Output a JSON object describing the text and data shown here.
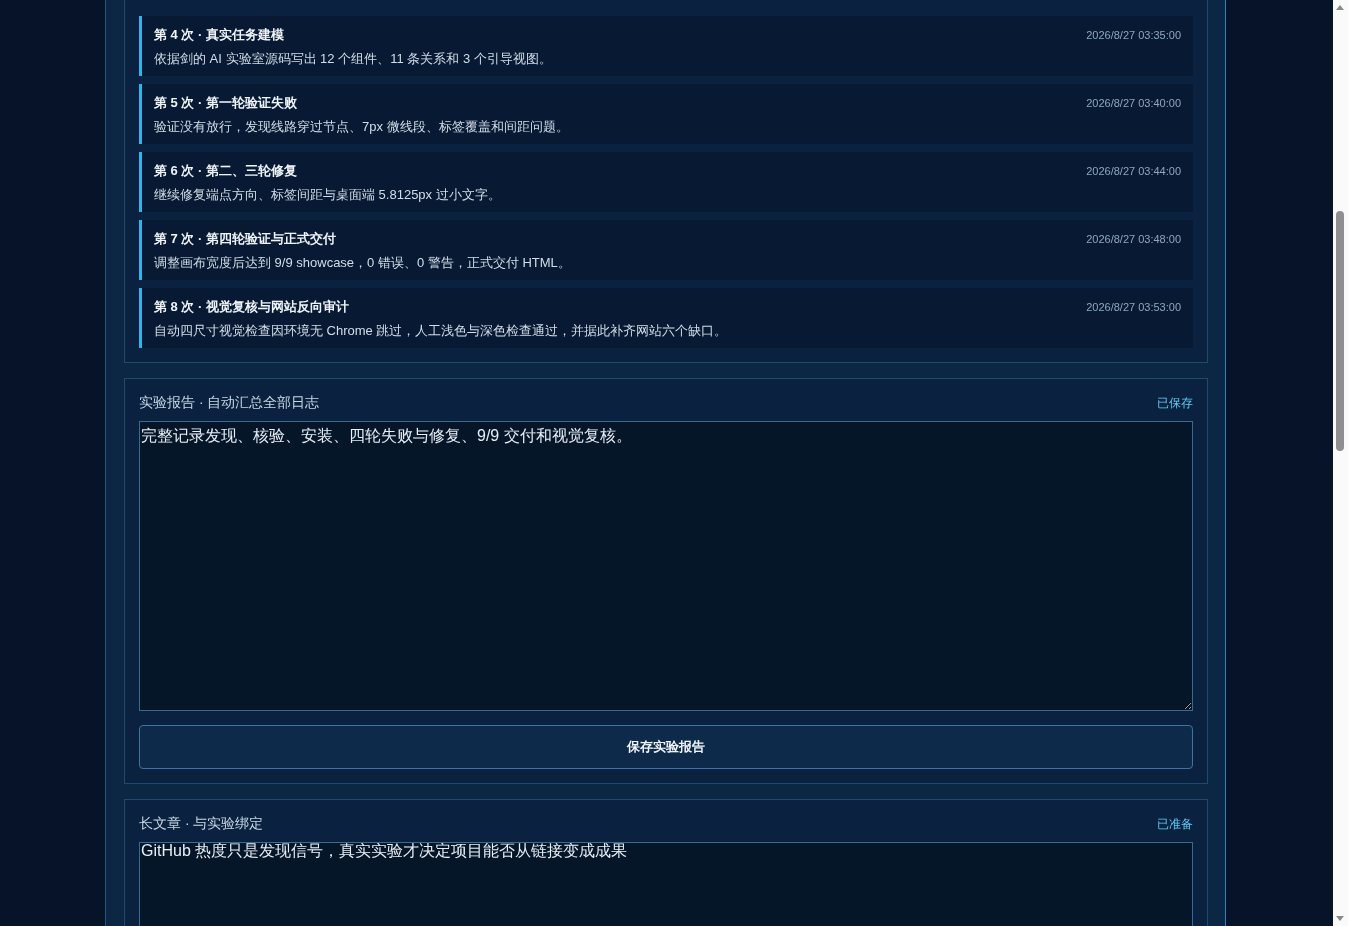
{
  "log_entries": [
    {
      "title": "第 4 次 · 真实任务建模",
      "time": "2026/8/27 03:35:00",
      "text": "依据剑的 AI 实验室源码写出 12 个组件、11 条关系和 3 个引导视图。"
    },
    {
      "title": "第 5 次 · 第一轮验证失败",
      "time": "2026/8/27 03:40:00",
      "text": "验证没有放行，发现线路穿过节点、7px 微线段、标签覆盖和间距问题。"
    },
    {
      "title": "第 6 次 · 第二、三轮修复",
      "time": "2026/8/27 03:44:00",
      "text": "继续修复端点方向、标签间距与桌面端 5.8125px 过小文字。"
    },
    {
      "title": "第 7 次 · 第四轮验证与正式交付",
      "time": "2026/8/27 03:48:00",
      "text": "调整画布宽度后达到 9/9 showcase，0 错误、0 警告，正式交付 HTML。"
    },
    {
      "title": "第 8 次 · 视觉复核与网站反向审计",
      "time": "2026/8/27 03:53:00",
      "text": "自动四尺寸视觉检查因环境无 Chrome 跳过，人工浅色与深色检查通过，并据此补齐网站六个缺口。"
    }
  ],
  "report": {
    "title": "实验报告 · 自动汇总全部日志",
    "status": "已保存",
    "value": "完整记录发现、核验、安装、四轮失败与修复、9/9 交付和视觉复核。",
    "button": "保存实验报告"
  },
  "article": {
    "title": "长文章 · 与实验绑定",
    "status": "已准备",
    "value": "GitHub 热度只是发现信号，真实实验才决定项目能否从链接变成成果"
  }
}
